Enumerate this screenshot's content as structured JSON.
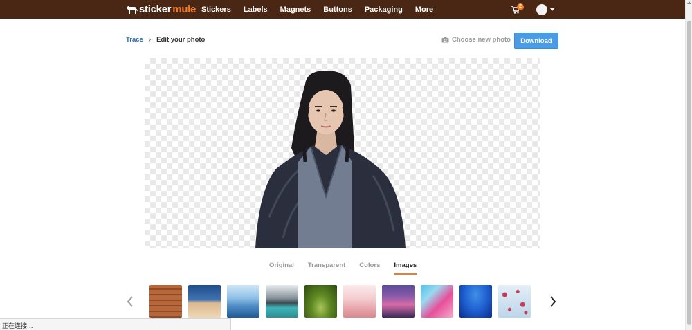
{
  "header": {
    "logo_text_1": "sticker",
    "logo_text_2": "mule",
    "nav": [
      "Stickers",
      "Labels",
      "Magnets",
      "Buttons",
      "Packaging",
      "More"
    ],
    "cart_count": "2",
    "icons": [
      "mule-logo-icon",
      "cart-icon",
      "avatar",
      "chevron-down-icon"
    ]
  },
  "breadcrumb": {
    "parent": "Trace",
    "separator": "›",
    "current": "Edit your photo"
  },
  "actions": {
    "choose_label": "Choose new photo",
    "download_label": "Download"
  },
  "tabs": [
    {
      "label": "Original",
      "active": false
    },
    {
      "label": "Transparent",
      "active": false
    },
    {
      "label": "Colors",
      "active": false
    },
    {
      "label": "Images",
      "active": true
    }
  ],
  "thumbnails": [
    {
      "name": "brick-wall",
      "colors": [
        "#b8673b",
        "#8f4a26"
      ]
    },
    {
      "name": "desert-sky",
      "colors": [
        "#2a5d9a",
        "#e8c9a0"
      ]
    },
    {
      "name": "blue-mountains",
      "colors": [
        "#aed4ef",
        "#2f6fa8"
      ]
    },
    {
      "name": "mountain-lake",
      "colors": [
        "#d9dde0",
        "#3fb3b8"
      ]
    },
    {
      "name": "forest-path",
      "colors": [
        "#6f9a2a",
        "#2f4a12"
      ]
    },
    {
      "name": "pink-hills",
      "colors": [
        "#f6d7d9",
        "#e39aa2"
      ]
    },
    {
      "name": "canal-town",
      "colors": [
        "#6a4fa0",
        "#d86aa8"
      ]
    },
    {
      "name": "paint-swirl",
      "colors": [
        "#4fc3e8",
        "#e84f9a"
      ]
    },
    {
      "name": "underwater",
      "colors": [
        "#1f6fd1",
        "#0a3aa0"
      ]
    },
    {
      "name": "petals",
      "colors": [
        "#cfe2f0",
        "#c23b5a"
      ]
    }
  ],
  "status_text": "正在连接...",
  "colors": {
    "header_bg": "#4a2614",
    "accent": "#f37b21",
    "link": "#2a6bb0",
    "button": "#4a9be6"
  }
}
